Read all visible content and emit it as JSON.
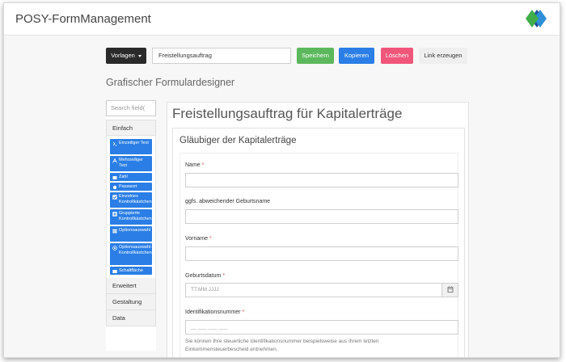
{
  "app": {
    "title": "POSY-FormManagement",
    "logo_icon": "diamond-logo-icon"
  },
  "toolbar": {
    "templates_label": "Vorlagen",
    "form_name_value": "Freistellungsauftrag",
    "save_label": "Speichern",
    "copy_label": "Kopieren",
    "delete_label": "Löschen",
    "link_label": "Link erzeugen",
    "colors": {
      "save": "#5cb85c",
      "copy": "#2a7ee6",
      "delete": "#f0567a",
      "templates": "#2a2a2a"
    }
  },
  "designer": {
    "heading": "Grafischer Formulardesigner"
  },
  "sidebar": {
    "search_placeholder": "Search field(",
    "categories": {
      "simple": "Einfach",
      "advanced": "Erweitert",
      "design": "Gestaltung",
      "data": "Data"
    },
    "tools": [
      {
        "label": "Einzeiliger Text",
        "icon": "text-cursor-icon"
      },
      {
        "label": "Mehrzeiliger Text",
        "icon": "text-a-icon"
      },
      {
        "label": "Zahl",
        "icon": "number-icon"
      },
      {
        "label": "Passwort",
        "icon": "asterisk-icon"
      },
      {
        "label": "Einzelnes Kontrollkästchen",
        "icon": "checkbox-icon"
      },
      {
        "label": "Gruppierte Kontrollkästchen",
        "icon": "plus-square-icon"
      },
      {
        "label": "Optionsauswahl",
        "icon": "list-icon"
      },
      {
        "label": "Optionsauswahl-Kontrollkästchen",
        "icon": "radio-icon"
      },
      {
        "label": "Schaltfläche",
        "icon": "button-icon"
      }
    ]
  },
  "form": {
    "title": "Freistellungsauftrag für Kapitalerträge",
    "section_title": "Gläubiger der Kapitalerträge",
    "fields": {
      "name": {
        "label": "Name",
        "required": "*"
      },
      "birth_name": {
        "label": "ggfs. abweichender Geburtsname"
      },
      "first_name": {
        "label": "Vorname",
        "required": "*"
      },
      "birth_date": {
        "label": "Geburtsdatum",
        "required": "*",
        "placeholder": "TT.MM.JJJJ"
      },
      "tax_id": {
        "label": "Identifikationsnummer",
        "required": "*",
        "placeholder": "__ ___ ___ ___",
        "help": "Sie können Ihre steuerliche Identifikationsnummer beispielsweise aus Ihrem letzten Einkommensteuerbescheid entnehmen."
      }
    }
  }
}
